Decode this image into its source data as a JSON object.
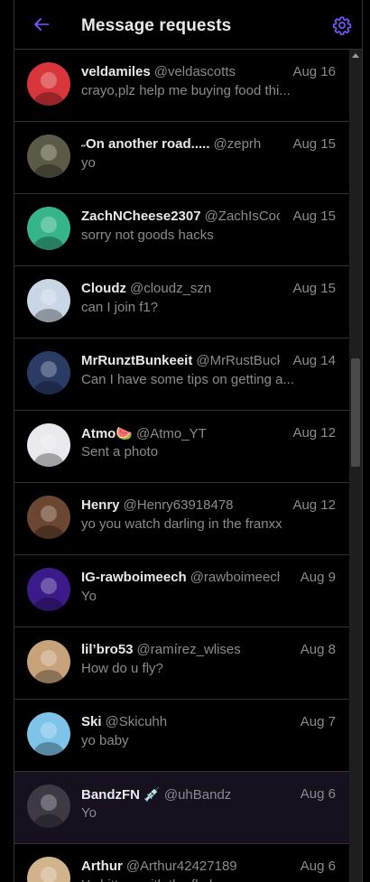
{
  "header": {
    "title": "Message requests",
    "back_icon": "arrow-left-icon",
    "settings_icon": "gear-icon",
    "accent": "#7856ff"
  },
  "requests": [
    {
      "name": "veldamiles",
      "handle": "@veldascotts",
      "date": "Aug 16",
      "preview": "crayo,plz help me buying food thi...",
      "avatar": "#d8363a"
    },
    {
      "name": "˶On another road.....",
      "handle": "@zeprh",
      "date": "Aug 15",
      "preview": "yo",
      "avatar": "#5b5a46"
    },
    {
      "name": "ZachNCheese2307",
      "handle": "@ZachIsCool...",
      "date": "Aug 15",
      "preview": "sorry not goods hacks",
      "avatar": "#36b58a"
    },
    {
      "name": "Cloudz",
      "handle": "@cloudz_szn",
      "date": "Aug 15",
      "preview": "can I join f1?",
      "avatar": "#c9d6e6"
    },
    {
      "name": "MrRunztBunkeeit",
      "handle": "@MrRustBucket...",
      "date": "Aug 14",
      "preview": "Can I have some tips on getting a...",
      "avatar": "#2a3b66"
    },
    {
      "name": "Atmo🍉",
      "handle": "@Atmo_YT",
      "date": "Aug 12",
      "preview": "Sent a photo",
      "avatar": "#e9e9ee"
    },
    {
      "name": "Henry",
      "handle": "@Henry63918478",
      "date": "Aug 12",
      "preview": "yo you watch darling in the franxx",
      "avatar": "#6b4630"
    },
    {
      "name": "IG-rawboimeech",
      "handle": "@rawboimeech",
      "date": "Aug 9",
      "preview": "Yo",
      "avatar": "#3b1a8a"
    },
    {
      "name": "lil’bro53",
      "handle": "@ramírez_wlises",
      "date": "Aug 8",
      "preview": "How do u fly?",
      "avatar": "#c8a27a"
    },
    {
      "name": "Ski",
      "handle": "@Skicuhh",
      "date": "Aug 7",
      "preview": "yo baby",
      "avatar": "#7ec3e8"
    },
    {
      "name": "BandzFN 💉",
      "handle": "@uhBandz",
      "date": "Aug 6",
      "preview": "Yo",
      "avatar": "#3d3a44",
      "active": true
    },
    {
      "name": "Arthur",
      "handle": "@Arthur42427189",
      "date": "Aug 6",
      "preview": "Yo bitte ...with the fl...l...",
      "avatar": "#d2b48c"
    }
  ]
}
